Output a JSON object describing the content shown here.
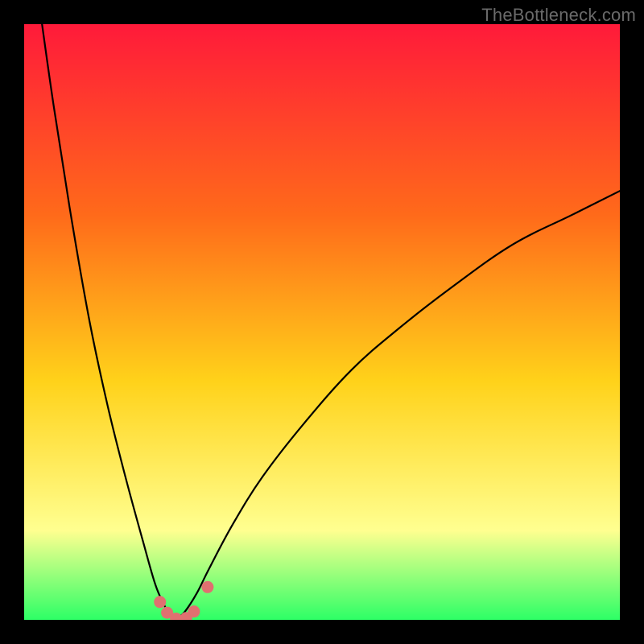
{
  "attribution": "TheBottleneck.com",
  "colors": {
    "frame": "#000000",
    "gradient_top": "#ff1a3a",
    "gradient_mid_top": "#ff6a1a",
    "gradient_mid": "#ffd21a",
    "gradient_mid_bottom": "#ffff90",
    "gradient_bottom": "#2dff66",
    "curve": "#000000",
    "marker_fill": "#e07070",
    "marker_stroke": "#c05858"
  },
  "chart_data": {
    "type": "line",
    "title": "",
    "xlabel": "",
    "ylabel": "",
    "xlim": [
      0,
      100
    ],
    "ylim": [
      0,
      100
    ],
    "grid": false,
    "legend": false,
    "note": "Values are estimated from pixel geometry; ticks and labels are absent in the source image. y is bottleneck percentage (0 bottom, 100 top).",
    "series": [
      {
        "name": "curve-left",
        "x": [
          3,
          5,
          8,
          11,
          14,
          17,
          20,
          22,
          23.5,
          24.5,
          25.5
        ],
        "y": [
          100,
          86,
          67,
          50,
          36,
          24,
          13,
          6,
          2.5,
          0.8,
          0
        ]
      },
      {
        "name": "curve-right",
        "x": [
          25.5,
          27,
          29,
          31,
          35,
          40,
          47,
          55,
          63,
          72,
          82,
          92,
          100
        ],
        "y": [
          0,
          1.4,
          4.5,
          8.5,
          16,
          24,
          33,
          42,
          49,
          56,
          63,
          68,
          72
        ]
      }
    ],
    "markers": [
      {
        "x": 22.8,
        "y": 3.0
      },
      {
        "x": 24.0,
        "y": 1.2
      },
      {
        "x": 25.5,
        "y": 0.2
      },
      {
        "x": 27.2,
        "y": 0.3
      },
      {
        "x": 28.5,
        "y": 1.4
      },
      {
        "x": 30.8,
        "y": 5.5
      }
    ]
  }
}
